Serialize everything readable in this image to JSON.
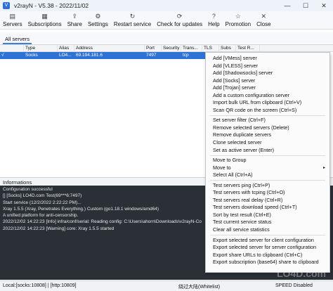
{
  "window": {
    "title": "v2rayN - V5.38 - 2022/11/02",
    "controls": {
      "minimize": "—",
      "maximize": "☐",
      "close": "✕"
    }
  },
  "toolbar": {
    "items": [
      {
        "label": "Servers",
        "icon": "servers-icon",
        "glyph": "▤"
      },
      {
        "label": "Subscriptions",
        "icon": "subscriptions-icon",
        "glyph": "▦"
      },
      {
        "label": "Share",
        "icon": "share-icon",
        "glyph": "⇪"
      },
      {
        "label": "Settings",
        "icon": "settings-icon",
        "glyph": "⚙"
      },
      {
        "label": "Restart service",
        "icon": "restart-icon",
        "glyph": "↻"
      },
      {
        "label": "Check for updates",
        "icon": "update-icon",
        "glyph": "⟳"
      },
      {
        "label": "Help",
        "icon": "help-icon",
        "glyph": "?"
      },
      {
        "label": "Promotion",
        "icon": "promotion-icon",
        "glyph": "☆"
      },
      {
        "label": "Close",
        "icon": "close-icon",
        "glyph": "✕"
      }
    ]
  },
  "tabs": {
    "active": "All servers"
  },
  "table": {
    "headers": [
      "Type",
      "Alias",
      "Address",
      "Port",
      "Security",
      "Trans...",
      "TLS",
      "Subs",
      "Test R..."
    ],
    "rows": [
      {
        "check": "√",
        "type": "Socks",
        "alias": "LO4...",
        "address": "69.194.181.6",
        "port": "7497",
        "security": "",
        "transport": "tcp",
        "tls": "",
        "subs": "",
        "test": ""
      }
    ]
  },
  "context_menu": {
    "groups": [
      [
        "Add [VMess] server",
        "Add [VLESS] server",
        "Add [Shadowsocks] server",
        "Add [Socks] server",
        "Add [Trojan] server",
        "Add a custom configuration server",
        "Import bulk URL from clipboard (Ctrl+V)",
        "Scan QR code on the screen (Ctrl+S)"
      ],
      [
        "Set server filter (Ctrl+F)",
        "Remove selected servers (Delete)",
        "Remove duplicate servers",
        "Clone selected server",
        "Set as active server (Enter)"
      ],
      [
        "Move to Group",
        "Move to",
        "Select All (Ctrl+A)"
      ],
      [
        "Test servers ping (Ctrl+P)",
        "Test servers with tcping (Ctrl+O)",
        "Test servers real delay (Ctrl+R)",
        "Test servers download speed (Ctrl+T)",
        "Sort by test result (Ctrl+E)",
        "Test current service status",
        "Clear all service statistics"
      ],
      [
        "Export selected server for client configuration",
        "Export selected server for server configuration",
        "Export share URLs to clipboard (Ctrl+C)",
        "Export subscription (base64) share to clipboard"
      ]
    ]
  },
  "info": {
    "title": "Informations",
    "lines": [
      "Configuration successful",
      "[] [Socks] LO4D.com Test(69***6:7497)",
      "Start service (12/2/2022 2:22:22 PM)...",
      "Xray 1.5.5 (Xray, Penetrates Everything.) Custom (go1.18.1 windows/amd64)",
      "A unified platform for anti-censorship.",
      "2022/12/02 14:22:23 [Info] infra/conf/serial: Reading config: C:\\Users\\ahorn\\Downloads\\v2rayN-Co",
      "2022/12/02 14:22:23 [Warning] core: Xray 1.5.5 started"
    ]
  },
  "status": {
    "local": "Local:[socks:10808] | [http:10809]",
    "routing": "绕过大陆(Whitelist)",
    "speed": "SPEED Disabled"
  },
  "watermark": "LO4D.com"
}
